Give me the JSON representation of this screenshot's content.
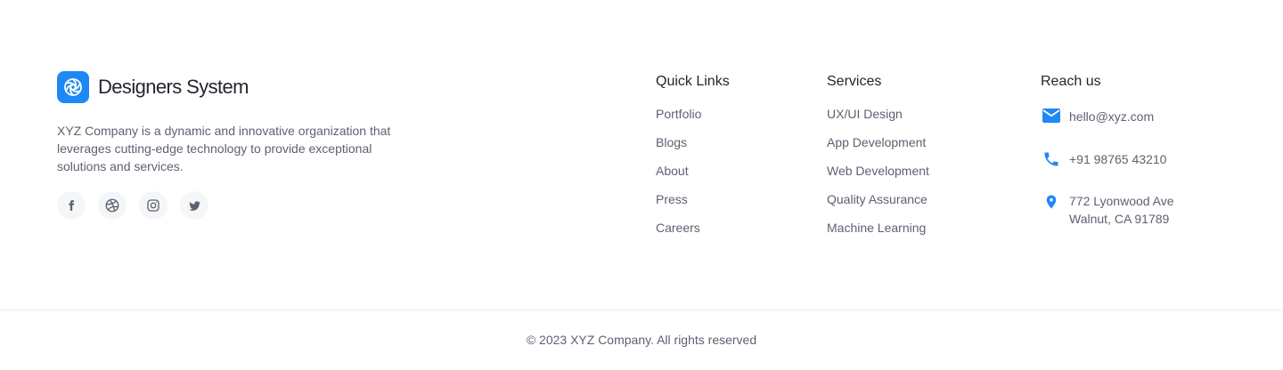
{
  "brand": {
    "name": "Designers System",
    "logo_icon": "aperture-icon",
    "logo_color": "#1e88f5",
    "description": "XYZ Company is a dynamic and innovative organization that leverages cutting-edge technology to provide exceptional solutions and services."
  },
  "socials": [
    {
      "icon": "facebook-icon"
    },
    {
      "icon": "dribbble-icon"
    },
    {
      "icon": "instagram-icon"
    },
    {
      "icon": "twitter-icon"
    }
  ],
  "quick_links": {
    "title": "Quick Links",
    "items": [
      "Portfolio",
      "Blogs",
      "About",
      "Press",
      "Careers"
    ]
  },
  "services": {
    "title": "Services",
    "items": [
      "UX/UI Design",
      "App Development",
      "Web Development",
      "Quality Assurance",
      "Machine Learning"
    ]
  },
  "reach_us": {
    "title": "Reach us",
    "email": "hello@xyz.com",
    "phone": "+91 98765 43210",
    "address_line1": "772 Lyonwood Ave",
    "address_line2": "Walnut, CA 91789",
    "icon_color": "#1e88f5"
  },
  "copyright": "© 2023 XYZ Company. All rights reserved"
}
